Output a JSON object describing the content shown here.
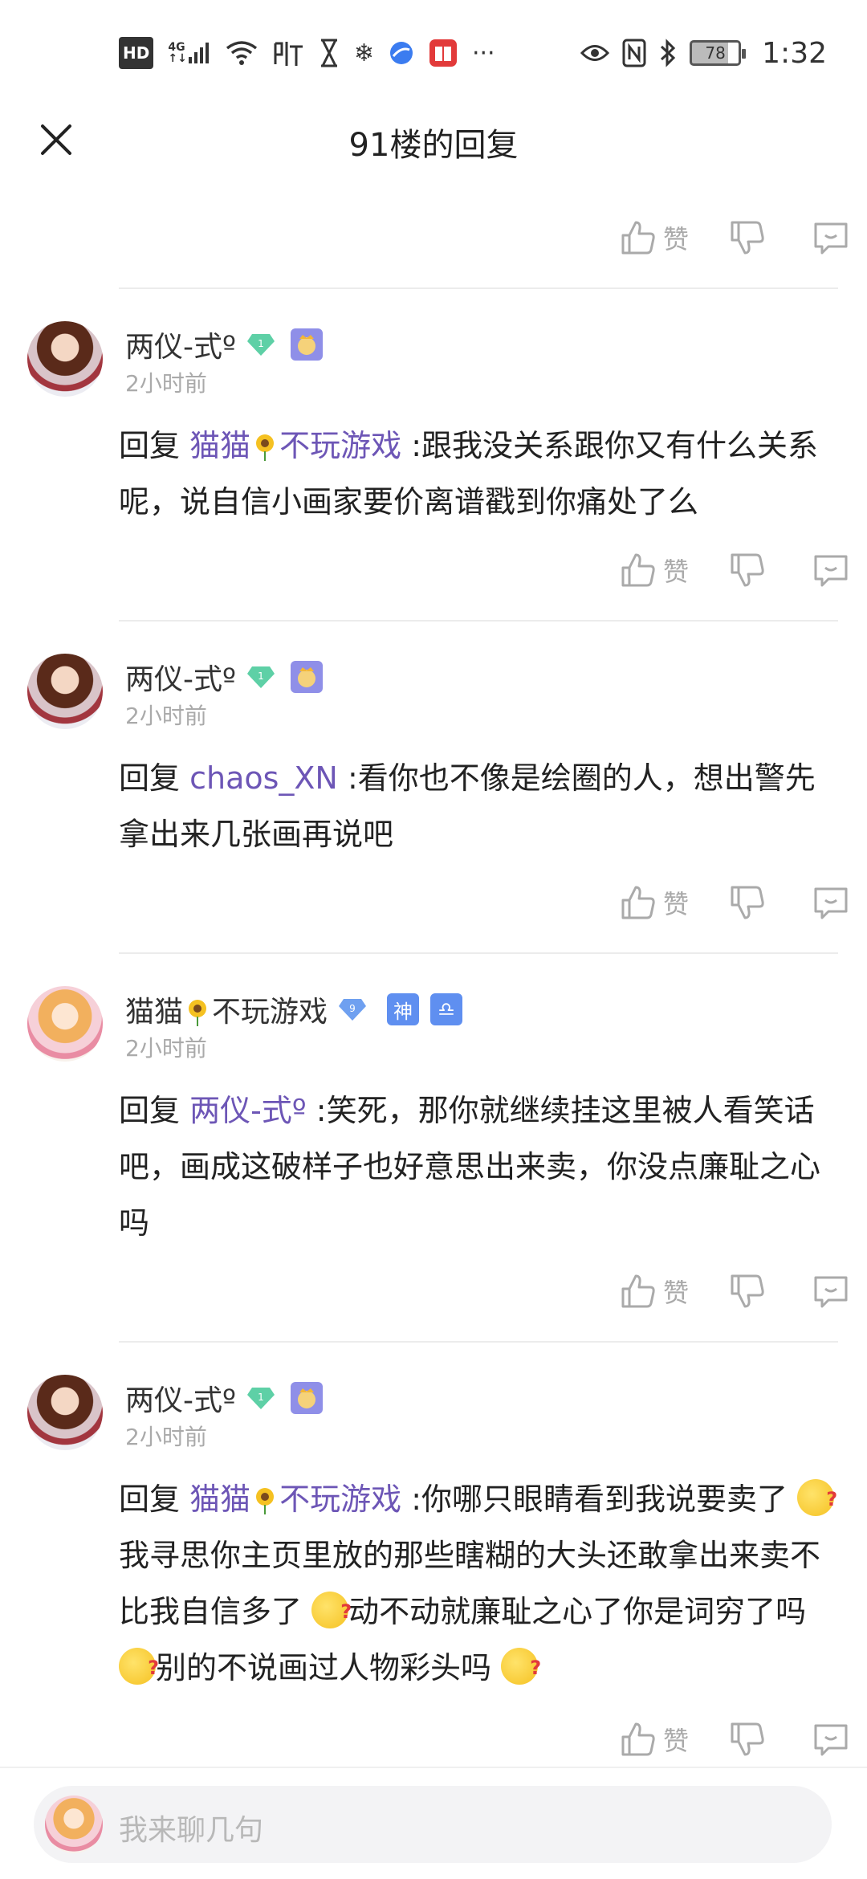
{
  "status_bar": {
    "left_icons": [
      "hd-icon",
      "4g-signal-icon",
      "wifi-icon",
      "listen-icon",
      "hourglass-icon",
      "snowflake-icon",
      "browser-icon",
      "book-icon",
      "more-icon"
    ],
    "hd_label": "HD",
    "net_label": "4G",
    "right_icons": [
      "eye-icon",
      "nfc-icon",
      "bluetooth-icon",
      "battery-icon"
    ],
    "battery": "78",
    "time": "1:32"
  },
  "header": {
    "title": "91楼的回复"
  },
  "like_label": "赞",
  "comments": [
    {
      "username": "两仪-式º",
      "level": "1",
      "time": "2小时前",
      "reply_prefix": "回复 ",
      "mention_a": "猫猫",
      "mention_b": "不玩游戏",
      "text": " :跟我没关系跟你又有什么关系呢，说自信小画家要价离谱戳到你痛处了么"
    },
    {
      "username": "两仪-式º",
      "level": "1",
      "time": "2小时前",
      "reply_prefix": "回复 ",
      "mention": "chaos_XN",
      "text": " :看你也不像是绘圈的人，想出警先拿出来几张画再说吧"
    },
    {
      "username_a": "猫猫",
      "username_b": "不玩游戏",
      "level": "9",
      "badge_1": "神",
      "badge_2": "♎",
      "time": "2小时前",
      "reply_prefix": "回复 ",
      "mention": "两仪-式º",
      "text": " :笑死，那你就继续挂这里被人看笑话吧，画成这破样子也好意思出来卖，你没点廉耻之心吗"
    },
    {
      "username": "两仪-式º",
      "level": "1",
      "time": "2小时前",
      "reply_prefix": "回复 ",
      "mention_a": "猫猫",
      "mention_b": "不玩游戏",
      "text_1": " :你哪只眼睛看到我说要卖了",
      "text_2": "我寻思你主页里放的那些瞎糊的大头还敢拿出来卖不比我自信多了",
      "text_3": "动不动就廉耻之心了你是词穷了吗",
      "text_4": "别的不说画过人物彩头吗"
    }
  ],
  "input": {
    "placeholder": "我来聊几句"
  }
}
